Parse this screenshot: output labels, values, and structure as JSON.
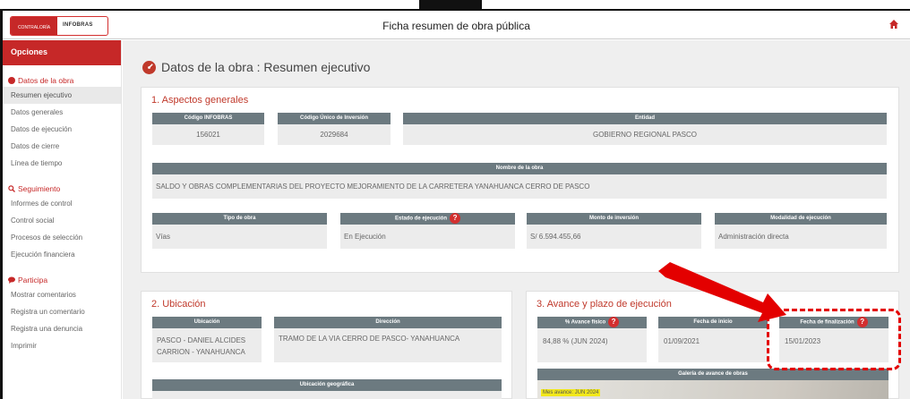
{
  "header": {
    "logo_left": "CONTRALORÍA",
    "logo_right": "INFOBRAS",
    "title": "Ficha resumen de obra pública"
  },
  "sidebar": {
    "opciones": "Opciones",
    "sections": [
      {
        "label": "Datos de la obra",
        "items": [
          "Resumen ejecutivo",
          "Datos generales",
          "Datos de ejecución",
          "Datos de cierre",
          "Línea de tiempo"
        ]
      },
      {
        "label": "Seguimiento",
        "items": [
          "Informes de control",
          "Control social",
          "Procesos de selección",
          "Ejecución financiera"
        ]
      },
      {
        "label": "Participa",
        "items": [
          "Mostrar comentarios",
          "Registra un comentario",
          "Registra una denuncia",
          "Imprimir"
        ]
      }
    ]
  },
  "main": {
    "page_title": "Datos de la obra : Resumen ejecutivo",
    "general": {
      "title": "1. Aspectos generales",
      "codigo_infobras_label": "Código INFOBRAS",
      "codigo_infobras": "156021",
      "codigo_inversion_label": "Código Único de Inversión",
      "codigo_inversion": "2029684",
      "entidad_label": "Entidad",
      "entidad": "GOBIERNO REGIONAL PASCO",
      "nombre_label": "Nombre de la obra",
      "nombre": "SALDO Y OBRAS COMPLEMENTARIAS DEL PROYECTO MEJORAMIENTO DE LA CARRETERA YANAHUANCA CERRO DE PASCO",
      "tipo_label": "Tipo de obra",
      "tipo": "Vías",
      "estado_label": "Estado de ejecución",
      "estado": "En Ejecución",
      "monto_label": "Monto de inversión",
      "monto": "S/ 6.594.455,66",
      "modalidad_label": "Modalidad de ejecución",
      "modalidad": "Administración directa"
    },
    "ubicacion": {
      "title": "2. Ubicación",
      "ubicacion_label": "Ubicación",
      "ubicacion": "PASCO - DANIEL ALCIDES CARRION - YANAHUANCA",
      "direccion_label": "Dirección",
      "direccion": "TRAMO DE LA VIA CERRO DE PASCO- YANAHUANCA",
      "geo_label": "Ubicación geográfica"
    },
    "avance": {
      "title": "3. Avance y plazo de ejecución",
      "fisico_label": "% Avance físico",
      "fisico": "84,88 % (JUN 2024)",
      "inicio_label": "Fecha de inicio",
      "inicio": "01/09/2021",
      "fin_label": "Fecha de finalización",
      "fin": "15/01/2023",
      "galeria_label": "Galería de avance de obras",
      "mes": "Mes avance: JUN 2024"
    }
  },
  "colors": {
    "accent": "#c62828",
    "header_gray": "#6c7a80",
    "annotation": "#e30000"
  }
}
